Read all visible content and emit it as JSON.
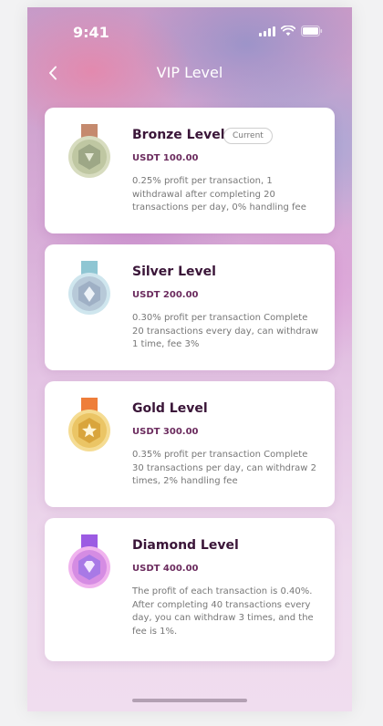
{
  "status_bar": {
    "time": "9:41"
  },
  "header": {
    "title": "VIP Level",
    "back_icon": "chevron-left-icon"
  },
  "levels": [
    {
      "name": "Bronze Level",
      "badge": "Current",
      "price": "USDT 100.00",
      "description": "0.25% profit per transaction, 1 withdrawal after completing 20 transactions per day, 0% handling fee",
      "icon": "bronze-medal-icon",
      "colors": {
        "ribbon": "#c58a6e",
        "outer": "#d7dcbf",
        "inner": "#9da786"
      }
    },
    {
      "name": "Silver Level",
      "price": "USDT 200.00",
      "description": "0.30% profit per transaction Complete 20 transactions every day, can withdraw 1 time, fee 3%",
      "icon": "silver-medal-icon",
      "colors": {
        "ribbon": "#8fc6d3",
        "outer": "#cfe6ee",
        "inner": "#9fb0c5"
      }
    },
    {
      "name": "Gold Level",
      "price": "USDT 300.00",
      "description": "0.35% profit per transaction Complete 30 transactions per day, can withdraw 2 times, 2% handling fee",
      "icon": "gold-medal-icon",
      "colors": {
        "ribbon": "#ee7e3a",
        "outer": "#f5dc93",
        "inner": "#d9a53c"
      }
    },
    {
      "name": "Diamond Level",
      "price": "USDT 400.00",
      "description": "The profit of each transaction is 0.40%. After completing 40 transactions every day, you can withdraw 3 times, and the fee is 1%.",
      "icon": "diamond-medal-icon",
      "colors": {
        "ribbon": "#9c5be3",
        "outer": "#f0b3ee",
        "inner": "#a879e6"
      }
    }
  ]
}
